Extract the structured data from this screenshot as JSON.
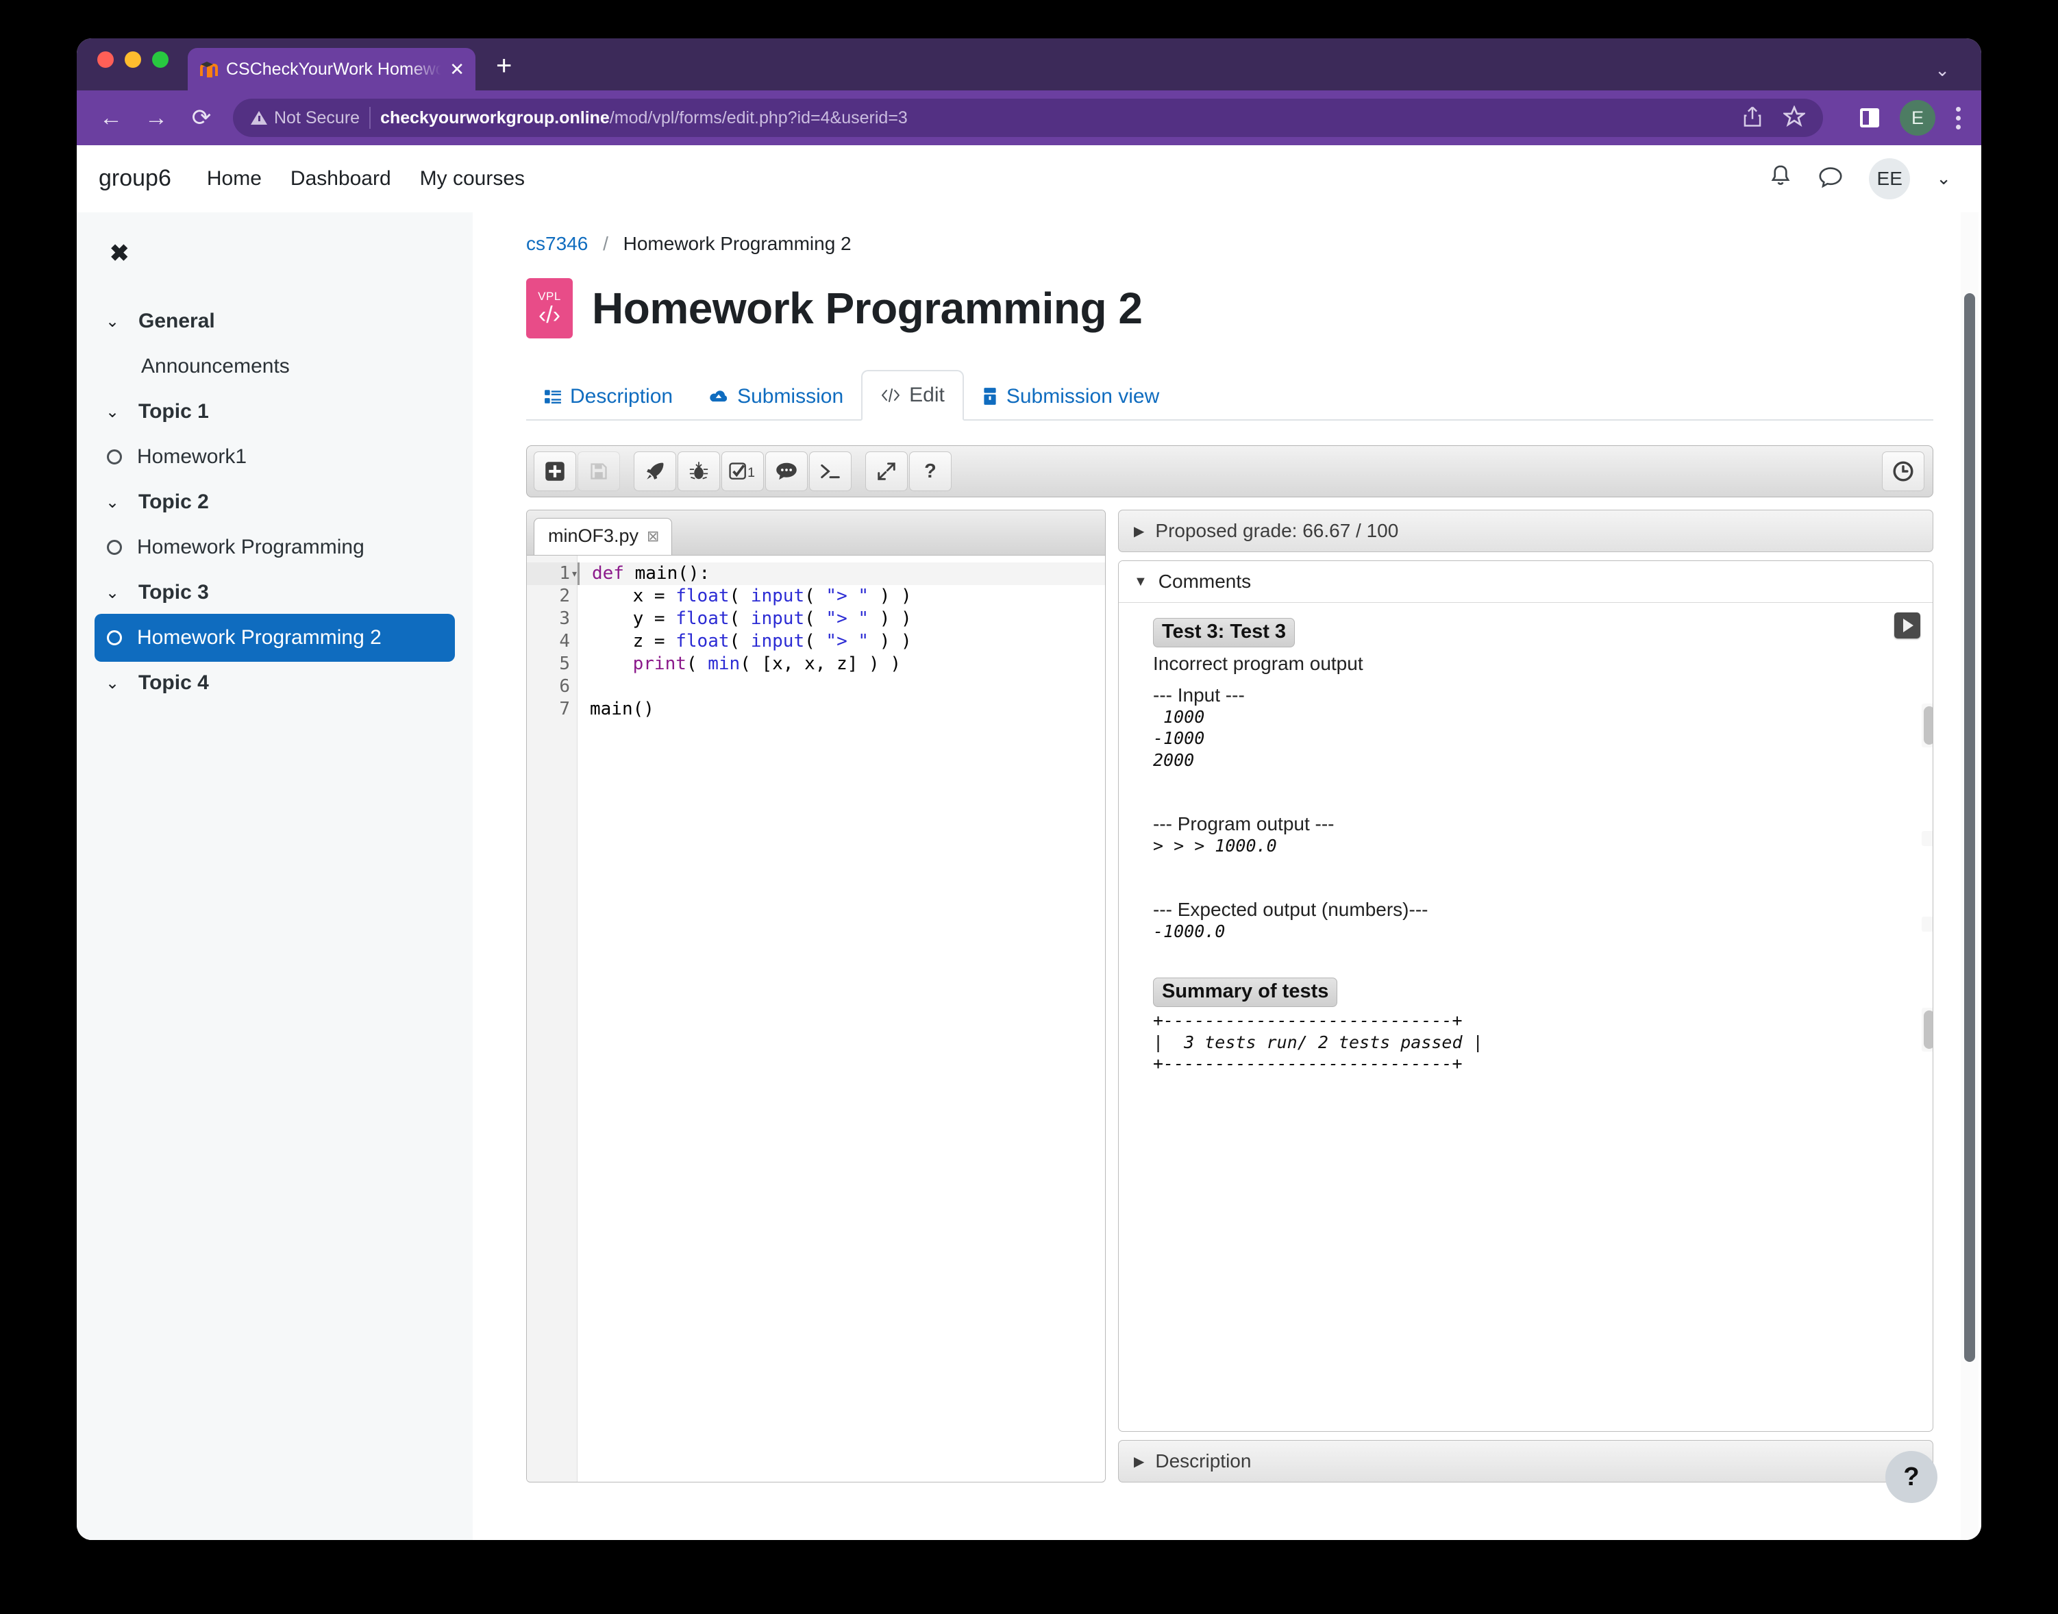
{
  "browser": {
    "tab": {
      "title": "CSCheckYourWork Homework",
      "favicon": "moodle-logo-icon",
      "close_label": "✕"
    },
    "new_tab_label": "+",
    "tabstrip_chevron": "⌄",
    "nav": {
      "back": "←",
      "forward": "→",
      "reload": "⟳"
    },
    "omnibox": {
      "security_label": "Not Secure",
      "host": "checkyourworkgroup.online",
      "path": "/mod/vpl/forms/edit.php?id=4&userid=3"
    },
    "toolbar": {
      "share": "share-icon",
      "bookmark": "star-icon",
      "sidebar": "sidebar-toggle-icon",
      "profile_initial": "E",
      "menu": "kebab-menu-icon"
    }
  },
  "moodle": {
    "site_name": "group6",
    "nav_links": [
      "Home",
      "Dashboard",
      "My courses"
    ],
    "header_icons": {
      "notifications": "bell-icon",
      "messages": "message-icon"
    },
    "avatar_initials": "EE",
    "avatar_caret": "⌄"
  },
  "course_index": {
    "close_label": "✖",
    "sections": [
      {
        "type": "section",
        "label": "General",
        "chevron": "⌄"
      },
      {
        "type": "item-plain",
        "label": "Announcements"
      },
      {
        "type": "section",
        "label": "Topic 1",
        "chevron": "⌄"
      },
      {
        "type": "item",
        "label": "Homework1",
        "active": false
      },
      {
        "type": "section",
        "label": "Topic 2",
        "chevron": "⌄"
      },
      {
        "type": "item",
        "label": "Homework Programming",
        "active": false
      },
      {
        "type": "section",
        "label": "Topic 3",
        "chevron": "⌄"
      },
      {
        "type": "item",
        "label": "Homework Programming 2",
        "active": true
      },
      {
        "type": "section",
        "label": "Topic 4",
        "chevron": "⌄"
      }
    ]
  },
  "breadcrumb": {
    "course": "cs7346",
    "separator": "/",
    "current": "Homework Programming 2"
  },
  "page": {
    "logo_word": "VPL",
    "logo_code": "‹/›",
    "title": "Homework Programming 2"
  },
  "tabs": [
    {
      "label": "Description",
      "icon": "description-icon",
      "active": false
    },
    {
      "label": "Submission",
      "icon": "upload-cloud-icon",
      "active": false
    },
    {
      "label": "Edit",
      "icon": "code-icon",
      "active": true
    },
    {
      "label": "Submission view",
      "icon": "submission-view-icon",
      "active": false
    }
  ],
  "ide": {
    "toolbar": [
      {
        "name": "new-file-button",
        "icon": "plus-square-icon",
        "disabled": false
      },
      {
        "name": "save-button",
        "icon": "floppy-disk-icon",
        "disabled": true
      },
      {
        "name": "run-button",
        "icon": "rocket-icon",
        "disabled": false
      },
      {
        "name": "debug-button",
        "icon": "bug-icon",
        "disabled": false
      },
      {
        "name": "evaluate-button",
        "icon": "check-square-icon",
        "disabled": false,
        "badge": "1"
      },
      {
        "name": "comments-button",
        "icon": "speech-bubble-icon",
        "disabled": false
      },
      {
        "name": "console-button",
        "icon": "terminal-icon",
        "disabled": false
      },
      {
        "name": "fullscreen-button",
        "icon": "expand-arrows-icon",
        "disabled": false
      },
      {
        "name": "help-button",
        "icon": "question-mark-icon",
        "disabled": false
      }
    ],
    "clock_button": {
      "name": "timer-button",
      "icon": "clock-icon"
    },
    "file": {
      "name": "minOF3.py",
      "close": "⊠"
    },
    "code_lines": [
      {
        "n": "1",
        "fold": "▾",
        "html": "<span class='kw'>def</span> main():"
      },
      {
        "n": "2",
        "fold": "",
        "html": "    x = <span class='builtin'>float</span>( <span class='builtin'>input</span>( <span class='str'>\"&gt; \"</span> ) )"
      },
      {
        "n": "3",
        "fold": "",
        "html": "    y = <span class='builtin'>float</span>( <span class='builtin'>input</span>( <span class='str'>\"&gt; \"</span> ) )"
      },
      {
        "n": "4",
        "fold": "",
        "html": "    z = <span class='builtin'>float</span>( <span class='builtin'>input</span>( <span class='str'>\"&gt; \"</span> ) )"
      },
      {
        "n": "5",
        "fold": "",
        "html": "    <span class='kw'>print</span>( <span class='builtin'>min</span>( [x, x, z] ) )"
      },
      {
        "n": "6",
        "fold": "",
        "html": ""
      },
      {
        "n": "7",
        "fold": "",
        "html": "main()"
      }
    ]
  },
  "results": {
    "grade_panel": {
      "tri": "▶",
      "label": "Proposed grade: 66.67 / 100"
    },
    "comments_panel": {
      "tri": "▼",
      "label": "Comments"
    },
    "run_button_icon": "play-icon",
    "test_badge": "Test 3: Test 3",
    "test_message": "Incorrect program output",
    "input_header": "--- Input ---",
    "input_body": " 1000\n-1000\n2000",
    "program_output_header": "--- Program output ---",
    "program_output_body": "> > > 1000.0",
    "expected_header": "--- Expected output (numbers)---",
    "expected_body": "-1000.0",
    "summary_badge": "Summary of tests",
    "summary_body": "+----------------------------+\n|  3 tests run/ 2 tests passed |\n+----------------------------+",
    "description_panel": {
      "tri": "▶",
      "label": "Description"
    }
  },
  "float_help_label": "?"
}
